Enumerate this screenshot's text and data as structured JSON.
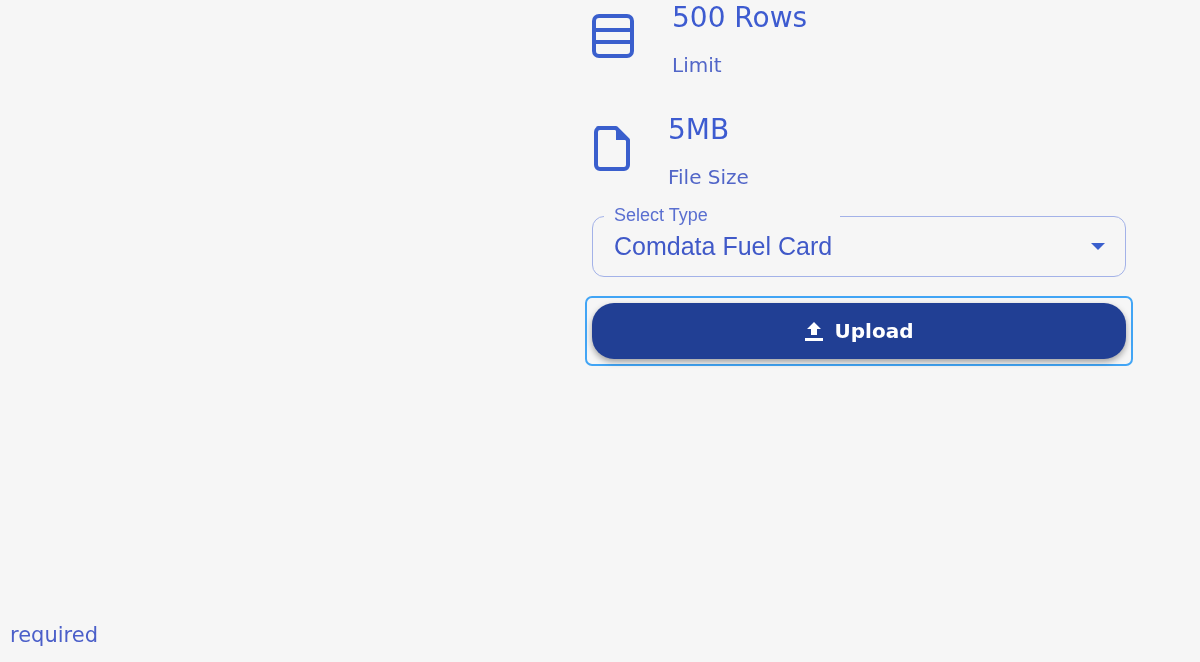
{
  "stats": [
    {
      "kind": "rows",
      "value": "500 Rows",
      "label": "Limit"
    },
    {
      "kind": "file",
      "value": "5MB",
      "label": "File Size"
    }
  ],
  "type_select": {
    "label": "Select Type",
    "value": "Comdata Fuel Card"
  },
  "upload_button": {
    "label": "Upload",
    "focused": true
  },
  "helper_text": "required"
}
